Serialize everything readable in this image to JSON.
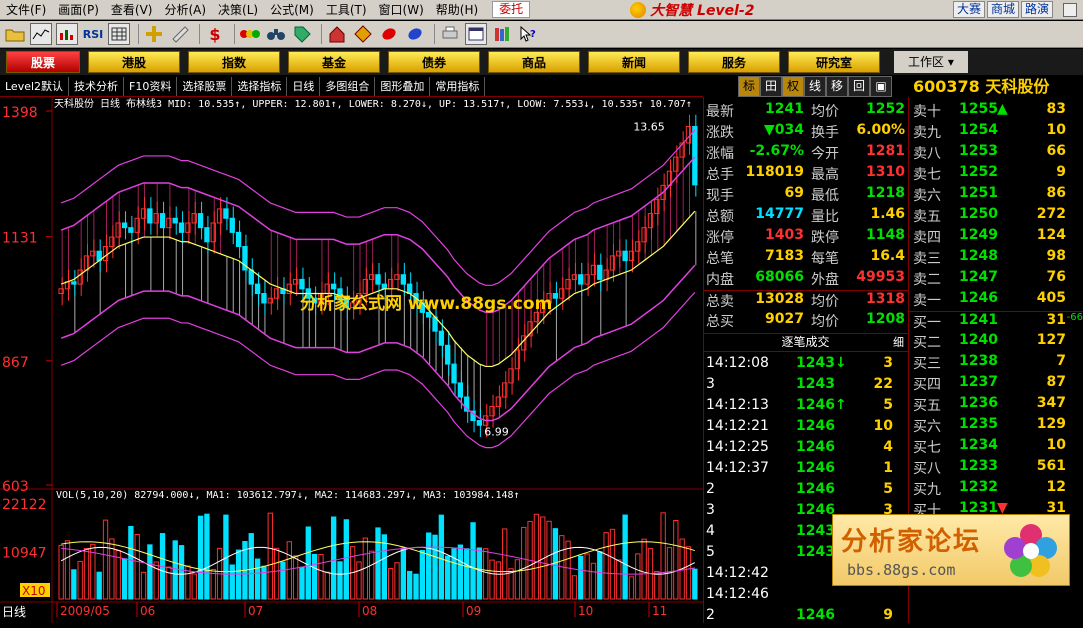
{
  "menu": {
    "items": [
      "文件(F)",
      "画面(P)",
      "查看(V)",
      "分析(A)",
      "决策(L)",
      "公式(M)",
      "工具(T)",
      "窗口(W)",
      "帮助(H)"
    ],
    "weituo": "委托",
    "brand": "大智慧 Level-2",
    "right_links": [
      "大赛",
      "商城",
      "路演"
    ]
  },
  "toolbar": {
    "rsi_label": "RSI",
    "dollar_label": "$"
  },
  "nav": {
    "buttons": [
      "股票",
      "港股",
      "指数",
      "基金",
      "债券",
      "商品",
      "新闻",
      "服务",
      "研究室"
    ],
    "active_index": 0,
    "workarea": "工作区"
  },
  "subbar": {
    "items": [
      "Level2默认",
      "技术分析",
      "F10资料",
      "选择股票",
      "选择指标",
      "日线",
      "多图组合",
      "图形叠加",
      "常用指标"
    ],
    "right_tabs": [
      "标",
      "田",
      "权",
      "线",
      "移",
      "回",
      "▣"
    ]
  },
  "chart": {
    "title_line": "天科股份 日线 布林线3 MID: 10.535↑, UPPER: 12.801↑, LOWER: 8.270↓, UP: 13.517↑, LOOW: 7.553↓, 10.535↑ 10.707↑",
    "price_axis": [
      "1398",
      "1131",
      "867",
      "603"
    ],
    "high_label": "13.65",
    "low_label": "6.99",
    "watermark": "分析家公式网 www.88gs.com",
    "vol_title": "VOL(5,10,20) 82794.000↓, MA1: 103612.797↓, MA2: 114683.297↓, MA3: 103984.148↑",
    "vol_axis": [
      "22122",
      "10947"
    ],
    "vol_unit": "X10",
    "period_label": "日线",
    "date_axis": [
      "2009/05",
      "06",
      "07",
      "08",
      "09",
      "10",
      "11"
    ]
  },
  "chart_data": {
    "type": "candlestick",
    "title": "天科股份 日线 布林线3",
    "ylim": [
      6.03,
      13.98
    ],
    "months": [
      "2009/05",
      "06",
      "07",
      "08",
      "09",
      "10",
      "11"
    ],
    "close": [
      10.2,
      10.35,
      10.3,
      10.6,
      10.9,
      11.0,
      10.8,
      11.1,
      11.3,
      11.6,
      11.5,
      11.4,
      11.7,
      11.9,
      11.6,
      11.8,
      11.5,
      11.7,
      11.6,
      11.4,
      11.6,
      11.8,
      11.5,
      11.2,
      11.6,
      11.9,
      11.7,
      11.4,
      11.1,
      10.6,
      10.3,
      10.1,
      9.9,
      10.0,
      10.2,
      10.1,
      10.3,
      10.4,
      10.2,
      10.0,
      9.9,
      10.1,
      10.3,
      10.2,
      10.0,
      9.8,
      9.9,
      10.1,
      10.4,
      10.5,
      10.3,
      10.2,
      10.4,
      10.5,
      10.3,
      10.1,
      9.9,
      9.7,
      9.6,
      9.3,
      9.0,
      8.6,
      8.2,
      7.9,
      7.6,
      7.4,
      7.3,
      7.5,
      7.7,
      7.9,
      8.2,
      8.5,
      8.9,
      9.2,
      9.5,
      9.7,
      9.9,
      10.1,
      10.0,
      10.2,
      10.4,
      10.5,
      10.3,
      10.5,
      10.7,
      10.4,
      10.6,
      10.9,
      11.0,
      10.8,
      11.0,
      11.2,
      11.5,
      11.8,
      12.1,
      12.4,
      12.7,
      13.0,
      13.3,
      13.65,
      12.41
    ],
    "mid": [
      10.3,
      10.35,
      10.4,
      10.5,
      10.6,
      10.7,
      10.8,
      10.9,
      11.0,
      11.1,
      11.15,
      11.2,
      11.25,
      11.3,
      11.3,
      11.3,
      11.3,
      11.3,
      11.25,
      11.2,
      11.2,
      11.15,
      11.1,
      11.05,
      11.0,
      10.95,
      10.9,
      10.85,
      10.8,
      10.7,
      10.6,
      10.5,
      10.4,
      10.3,
      10.25,
      10.2,
      10.15,
      10.1,
      10.1,
      10.1,
      10.1,
      10.1,
      10.1,
      10.1,
      10.05,
      10.0,
      10.0,
      10.0,
      10.05,
      10.1,
      10.15,
      10.2,
      10.2,
      10.2,
      10.15,
      10.1,
      10.0,
      9.9,
      9.75,
      9.6,
      9.45,
      9.3,
      9.1,
      8.95,
      8.8,
      8.7,
      8.6,
      8.55,
      8.55,
      8.6,
      8.7,
      8.8,
      8.95,
      9.1,
      9.25,
      9.4,
      9.55,
      9.7,
      9.8,
      9.9,
      10.0,
      10.1,
      10.15,
      10.2,
      10.3,
      10.35,
      10.4,
      10.45,
      10.5,
      10.55,
      10.6,
      10.7,
      10.8,
      10.9,
      11.0,
      11.1,
      11.25,
      11.4,
      11.55,
      11.7,
      11.85
    ],
    "bands_width": 1.15,
    "volume_ma": [
      103612.797,
      114683.297,
      103984.148
    ],
    "last_volume": 82794.0
  },
  "quote": {
    "code": "600378",
    "name": "天科股份",
    "rows": [
      {
        "l1": "最新",
        "v1": "1241",
        "c1": "#00e000",
        "l2": "均价",
        "v2": "1252",
        "c2": "#00e000"
      },
      {
        "l1": "涨跌",
        "v1": "▼034",
        "c1": "#00e000",
        "l2": "换手",
        "v2": "6.00%",
        "c2": "#ffd000"
      },
      {
        "l1": "涨幅",
        "v1": "-2.67%",
        "c1": "#00e000",
        "l2": "今开",
        "v2": "1281",
        "c2": "#ff3030"
      },
      {
        "l1": "总手",
        "v1": "118019",
        "c1": "#ffd000",
        "l2": "最高",
        "v2": "1310",
        "c2": "#ff3030"
      },
      {
        "l1": "现手",
        "v1": "69",
        "c1": "#ffd000",
        "l2": "最低",
        "v2": "1218",
        "c2": "#00e000"
      },
      {
        "l1": "总额",
        "v1": "14777",
        "c1": "#00e0ff",
        "l2": "量比",
        "v2": "1.46",
        "c2": "#ffd000"
      },
      {
        "l1": "涨停",
        "v1": "1403",
        "c1": "#ff3030",
        "l2": "跌停",
        "v2": "1148",
        "c2": "#00e000"
      },
      {
        "l1": "总笔",
        "v1": "7183",
        "c1": "#ffd000",
        "l2": "每笔",
        "v2": "16.4",
        "c2": "#ffd000"
      },
      {
        "l1": "内盘",
        "v1": "68066",
        "c1": "#00e000",
        "l2": "外盘",
        "v2": "49953",
        "c2": "#ff3030"
      },
      {
        "l1": "总卖",
        "v1": "13028",
        "c1": "#ffd000",
        "l2": "均价",
        "v2": "1318",
        "c2": "#ff3030"
      },
      {
        "l1": "总买",
        "v1": "9027",
        "c1": "#ffd000",
        "l2": "均价",
        "v2": "1208",
        "c2": "#00e000"
      }
    ]
  },
  "book": {
    "asks": [
      {
        "label": "卖十",
        "price": "1255",
        "vol": "83",
        "mark": "▲"
      },
      {
        "label": "卖九",
        "price": "1254",
        "vol": "10",
        "mark": ""
      },
      {
        "label": "卖八",
        "price": "1253",
        "vol": "66",
        "mark": ""
      },
      {
        "label": "卖七",
        "price": "1252",
        "vol": "9",
        "mark": ""
      },
      {
        "label": "卖六",
        "price": "1251",
        "vol": "86",
        "mark": ""
      },
      {
        "label": "卖五",
        "price": "1250",
        "vol": "272",
        "mark": ""
      },
      {
        "label": "卖四",
        "price": "1249",
        "vol": "124",
        "mark": ""
      },
      {
        "label": "卖三",
        "price": "1248",
        "vol": "98",
        "mark": ""
      },
      {
        "label": "卖二",
        "price": "1247",
        "vol": "76",
        "mark": ""
      },
      {
        "label": "卖一",
        "price": "1246",
        "vol": "405",
        "mark": ""
      }
    ],
    "bids": [
      {
        "label": "买一",
        "price": "1241",
        "vol": "31",
        "mark": ""
      },
      {
        "label": "买二",
        "price": "1240",
        "vol": "127",
        "mark": ""
      },
      {
        "label": "买三",
        "price": "1238",
        "vol": "7",
        "mark": ""
      },
      {
        "label": "买四",
        "price": "1237",
        "vol": "87",
        "mark": ""
      },
      {
        "label": "买五",
        "price": "1236",
        "vol": "347",
        "mark": ""
      },
      {
        "label": "买六",
        "price": "1235",
        "vol": "129",
        "mark": ""
      },
      {
        "label": "买七",
        "price": "1234",
        "vol": "10",
        "mark": ""
      },
      {
        "label": "买八",
        "price": "1233",
        "vol": "561",
        "mark": ""
      },
      {
        "label": "买九",
        "price": "1232",
        "vol": "12",
        "mark": ""
      },
      {
        "label": "买十",
        "price": "1231",
        "vol": "31",
        "mark": "▼"
      }
    ],
    "side_marker": "-66"
  },
  "ticks": {
    "title": "逐笔成交",
    "detail": "细",
    "rows": [
      {
        "t": "14:12:08",
        "p": "1243↓",
        "v": "3"
      },
      {
        "t": "3",
        "p": "1243",
        "v": "22"
      },
      {
        "t": "14:12:13",
        "p": "1246↑",
        "v": "5"
      },
      {
        "t": "14:12:21",
        "p": "1246",
        "v": "10"
      },
      {
        "t": "14:12:25",
        "p": "1246",
        "v": "4"
      },
      {
        "t": "14:12:37",
        "p": "1246",
        "v": "1"
      },
      {
        "t": "2",
        "p": "1246",
        "v": "5"
      },
      {
        "t": "3",
        "p": "1246",
        "v": "3"
      },
      {
        "t": "4",
        "p": "1243",
        "v": ""
      },
      {
        "t": "5",
        "p": "1243",
        "v": ""
      },
      {
        "t": "14:12:42",
        "p": "",
        "v": ""
      },
      {
        "t": "14:12:46",
        "p": "",
        "v": ""
      },
      {
        "t": "2",
        "p": "1246",
        "v": "9"
      }
    ]
  },
  "forum": {
    "title": "分析家论坛",
    "url": "bbs.88gs.com"
  },
  "colors": {
    "up": "#ff3030",
    "down": "#00e000",
    "band": "#e040e0",
    "mid": "#ffff60",
    "accent": "#ffd000"
  }
}
